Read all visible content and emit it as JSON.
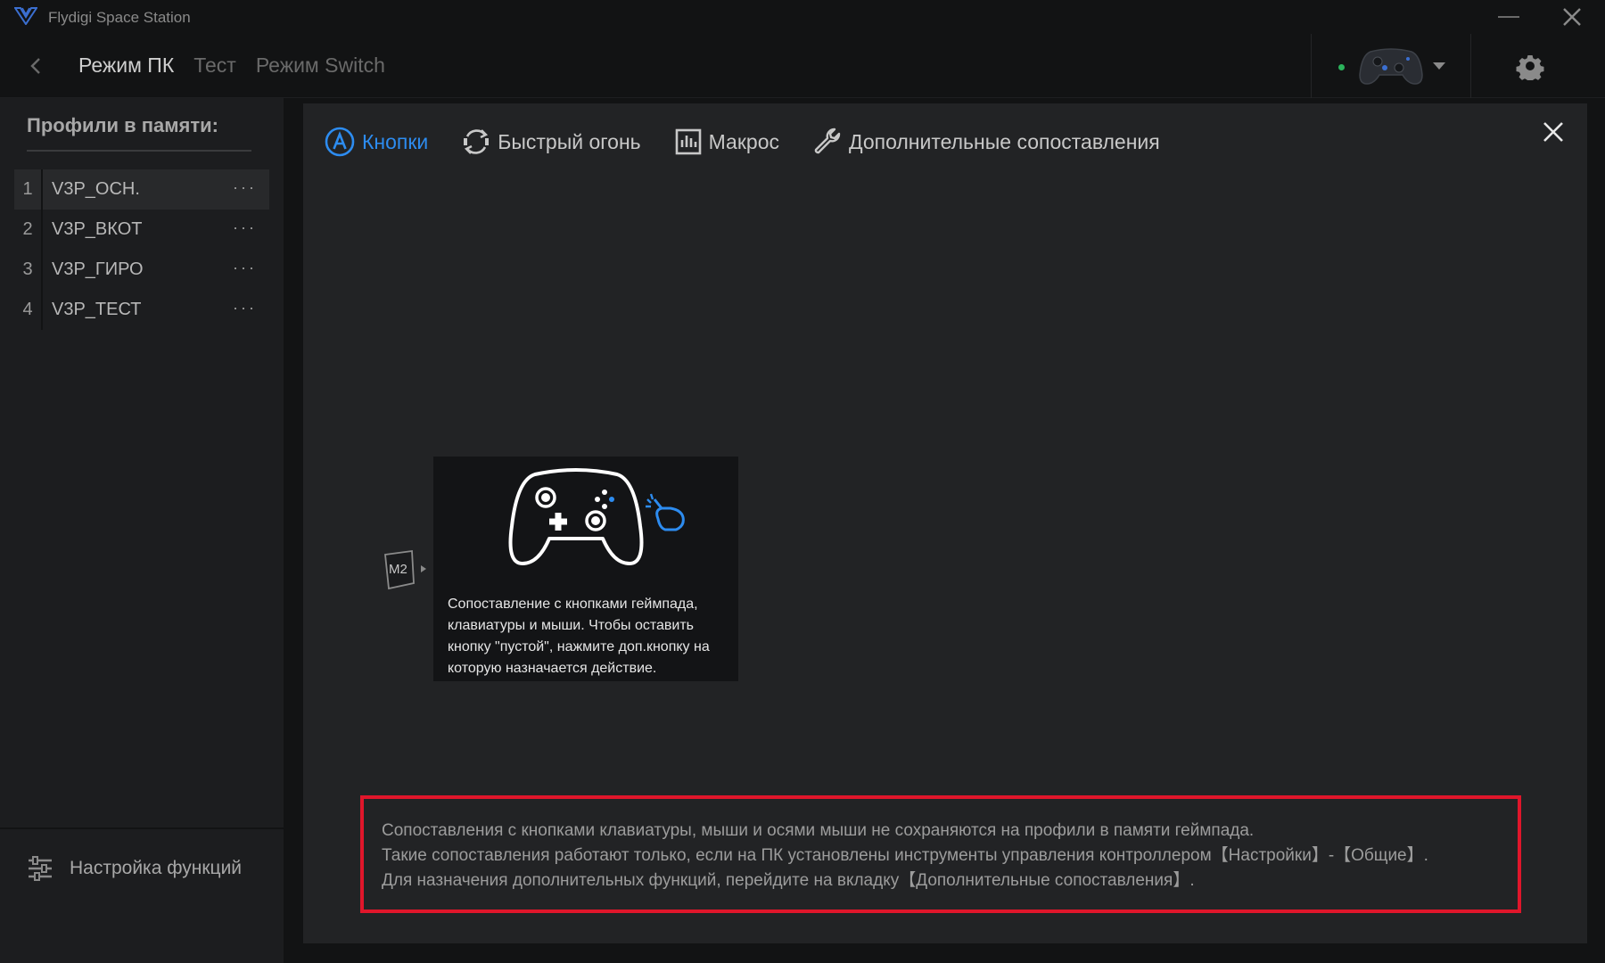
{
  "window": {
    "title": "Flydigi Space Station"
  },
  "nav": {
    "tabs": [
      "Режим ПК",
      "Тест",
      "Режим Switch"
    ],
    "active_tab": "Режим ПК"
  },
  "device": {
    "status_color": "#2bb35c",
    "icon": "gamepad-icon"
  },
  "sidebar": {
    "heading": "Профили в памяти:",
    "profiles": [
      {
        "number": "1",
        "name": "V3P_ОСН.",
        "more": "···"
      },
      {
        "number": "2",
        "name": "V3P_ВКОТ",
        "more": "···"
      },
      {
        "number": "3",
        "name": "V3P_ГИРО",
        "more": "···"
      },
      {
        "number": "4",
        "name": "V3P_ТЕСТ",
        "more": "···"
      }
    ],
    "selected_profile": "1",
    "footer_label": "Настройка функций"
  },
  "panel": {
    "tabs": [
      {
        "label": "Кнопки",
        "icon": "a-button-icon"
      },
      {
        "label": "Быстрый огонь",
        "icon": "rapid-fire-icon"
      },
      {
        "label": "Макрос",
        "icon": "macro-icon"
      },
      {
        "label": "Дополнительные сопоставления",
        "icon": "wrench-icon"
      }
    ],
    "active_tab": "Кнопки",
    "button_badge": "M2",
    "tooltip_text": "Сопоставление с кнопками геймпада, клавиатуры и мыши. Чтобы оставить кнопку \"пустой\", нажмите доп.кнопку на которую назначается действие.",
    "notice": {
      "line1": "Сопоставления с кнопками клавиатуры, мыши и осями мыши не сохраняются на профили в памяти геймпада.",
      "line2": "Такие сопоставления работают только, если на ПК установлены инструменты управления контроллером【Настройки】-【Общие】.",
      "line3": "Для назначения дополнительных функций, перейдите на вкладку【Дополнительные сопоставления】."
    }
  },
  "colors": {
    "accent": "#2d8cf0",
    "highlight_border": "#e0162b"
  }
}
